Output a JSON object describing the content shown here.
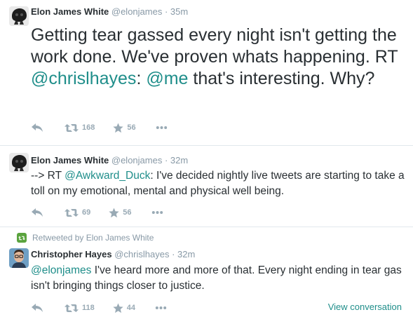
{
  "tweets": [
    {
      "name": "Elon James White",
      "handle": "@elonjames",
      "sep": "·",
      "time": "35m",
      "text_a": "Getting tear gassed every night isn't getting the work done. We've proven whats happening. RT ",
      "mention_1": "@chrislhayes",
      "text_b": ": ",
      "mention_2": "@me",
      "text_c": " that's interesting. Why?",
      "retweets": "168",
      "favorites": "56"
    },
    {
      "name": "Elon James White",
      "handle": "@elonjames",
      "sep": "·",
      "time": "32m",
      "text_a": "--> RT ",
      "mention_1": "@Awkward_Duck",
      "text_b": ": I've decided nightly live tweets are starting to take a toll on my emotional, mental and physical well being.",
      "retweets": "69",
      "favorites": "56"
    },
    {
      "retweeted_by": "Retweeted by Elon James White",
      "name": "Christopher Hayes",
      "handle": "@chrislhayes",
      "sep": "·",
      "time": "32m",
      "mention_1": "@elonjames",
      "text_a": " I've heard more and more of that. Every night ending in tear gas isn't bringing things closer to justice.",
      "retweets": "118",
      "favorites": "44",
      "view_conversation": "View conversation"
    }
  ],
  "icons": [
    "reply-icon",
    "retweet-icon",
    "favorite-icon",
    "more-icon",
    "retweet-badge-icon"
  ],
  "colors": {
    "link": "#1f8e8a",
    "muted": "#8899a6",
    "action": "#99aab5",
    "retweet_badge": "#5aa33e"
  }
}
